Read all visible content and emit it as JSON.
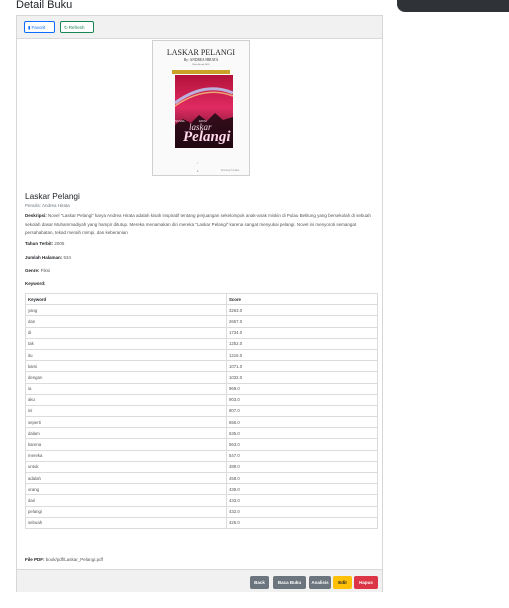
{
  "page": {
    "title": "Detail Buku"
  },
  "header_buttons": {
    "favorite": {
      "label": "Favorit",
      "icon": "bookmark-icon"
    },
    "refresh": {
      "label": "Refresh",
      "icon": "refresh-icon"
    }
  },
  "cover": {
    "title": "LASKAR PELANGI",
    "author": "By: ANDREA HIRATA",
    "subtitle": "Edisi Revisi 2005",
    "small_a": "NOVEL",
    "small_b": "EDISI",
    "laskar": "laskar",
    "pelangi": "Pelangi",
    "page_num": "1",
    "publisher": "Bentang Pustaka"
  },
  "book": {
    "title": "Laskar Pelangi",
    "author_label": "Penulis:",
    "author": "Andrea Hirata",
    "description_label": "Deskripsi:",
    "description": "Novel \"Laskar Pelangi\" karya Andrea Hirata adalah kisah inspiratif tentang perjuangan sekelompok anak-anak miskin di Pulau Belitung yang bersekolah di sebuah sekolah dasar Muhammadiyah yang hampir ditutup. Mereka menamakan diri mereka \"Laskar Pelangi\" karena sangat menyukai pelangi. Novel ini menyoroti semangat persahabatan, tekad meraih mimpi, dan keberanian",
    "year_label": "Tahun Terbit:",
    "year": "2005",
    "pages_label": "Jumlah Halaman:",
    "pages": "534",
    "genre_label": "Genre:",
    "genre": "Fiksi",
    "keyword_label": "Keyword:",
    "file_label": "File PDF:",
    "file": "book/pdf/Laskar_Pelangi.pdf"
  },
  "keywords_table": {
    "headers": [
      "Keyword",
      "Score"
    ],
    "rows": [
      [
        "yang",
        "3263.0"
      ],
      [
        "dan",
        "2657.0"
      ],
      [
        "di",
        "1734.0"
      ],
      [
        "tak",
        "1252.0"
      ],
      [
        "itu",
        "1216.0"
      ],
      [
        "kami",
        "1071.0"
      ],
      [
        "dengan",
        "1032.0"
      ],
      [
        "ia",
        "969.0"
      ],
      [
        "aku",
        "903.0"
      ],
      [
        "ini",
        "807.0"
      ],
      [
        "seperti",
        "656.0"
      ],
      [
        "dalam",
        "635.0"
      ],
      [
        "karena",
        "563.0"
      ],
      [
        "mereka",
        "547.0"
      ],
      [
        "untuk",
        "489.0"
      ],
      [
        "adalah",
        "458.0"
      ],
      [
        "orang",
        "439.0"
      ],
      [
        "dari",
        "433.0"
      ],
      [
        "pelangi",
        "432.0"
      ],
      [
        "sebuah",
        "426.0"
      ]
    ]
  },
  "footer_buttons": {
    "back": "Back",
    "baca": "Baca Buku",
    "analisis": "Analisis",
    "edit": "Edit",
    "hapus": "Hapus"
  },
  "colors": {
    "primary": "#0d6efd",
    "success": "#198754",
    "secondary": "#6c757d",
    "warning": "#ffc107",
    "danger": "#dc3545"
  }
}
